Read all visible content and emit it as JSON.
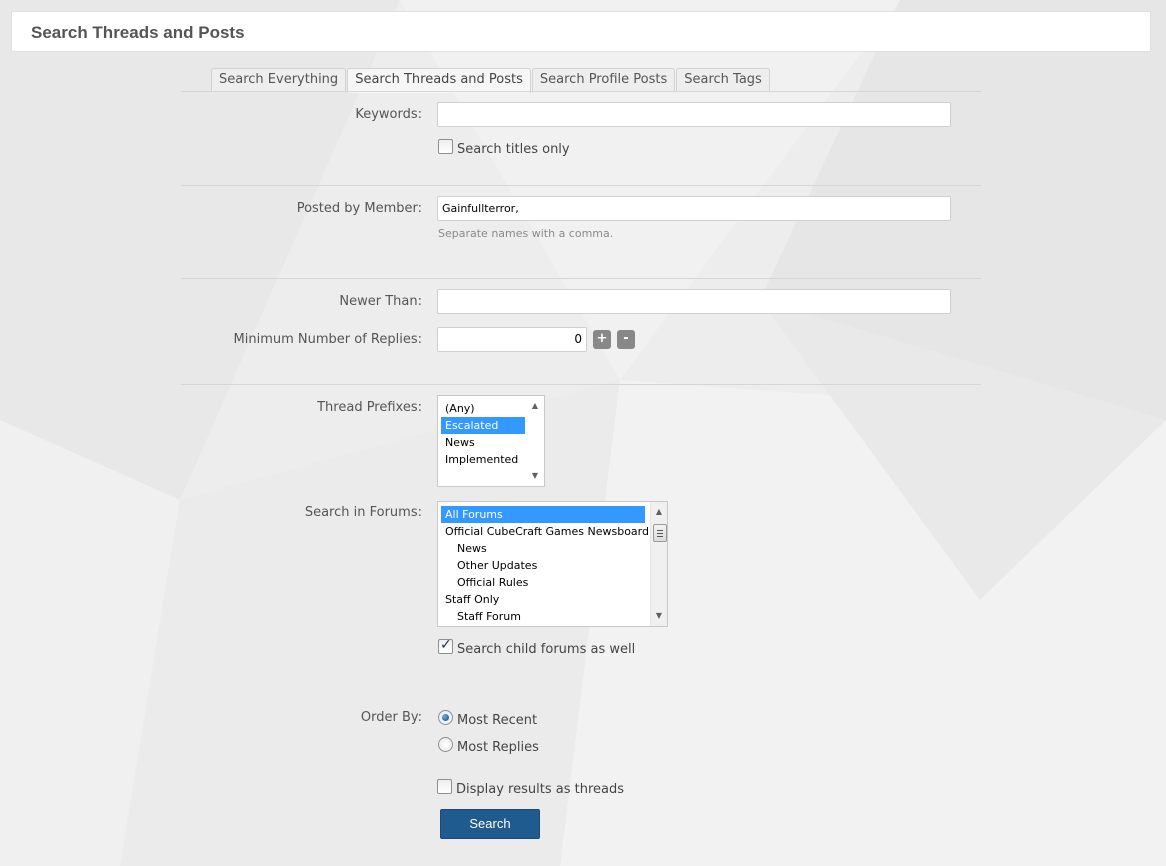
{
  "page": {
    "title": "Search Threads and Posts"
  },
  "tabs": [
    {
      "label": "Search Everything"
    },
    {
      "label": "Search Threads and Posts"
    },
    {
      "label": "Search Profile Posts"
    },
    {
      "label": "Search Tags"
    }
  ],
  "keywords": {
    "label": "Keywords:",
    "value": "",
    "titles_only_label": "Search titles only",
    "titles_only_checked": false
  },
  "posted_by": {
    "label": "Posted by Member:",
    "value": "Gainfullterror,",
    "hint": "Separate names with a comma."
  },
  "newer_than": {
    "label": "Newer Than:",
    "value": ""
  },
  "min_replies": {
    "label": "Minimum Number of Replies:",
    "value": "0",
    "plus": "+",
    "minus": "-"
  },
  "thread_prefixes": {
    "label": "Thread Prefixes:",
    "options": [
      "(Any)",
      "Escalated",
      "News",
      "Implemented"
    ],
    "selected": "Escalated"
  },
  "forums": {
    "label": "Search in Forums:",
    "options": [
      "All Forums",
      "Official CubeCraft Games Newsboard",
      "News",
      "Other Updates",
      "Official Rules",
      "Staff Only",
      "Staff Forum"
    ],
    "selected": "All Forums",
    "child_label": "Search child forums as well",
    "child_checked": true
  },
  "order_by": {
    "label": "Order By:",
    "options": [
      "Most Recent",
      "Most Replies"
    ],
    "selected": "Most Recent"
  },
  "display_threads": {
    "label": "Display results as threads",
    "checked": false
  },
  "search_button": {
    "label": "Search"
  },
  "colors": {
    "button": "#1f5b8e",
    "selection": "#3399ff"
  },
  "icons": {
    "up_arrow": "scroll-up-arrow-icon",
    "down_arrow": "scroll-down-arrow-icon",
    "check": "checkmark-icon"
  }
}
